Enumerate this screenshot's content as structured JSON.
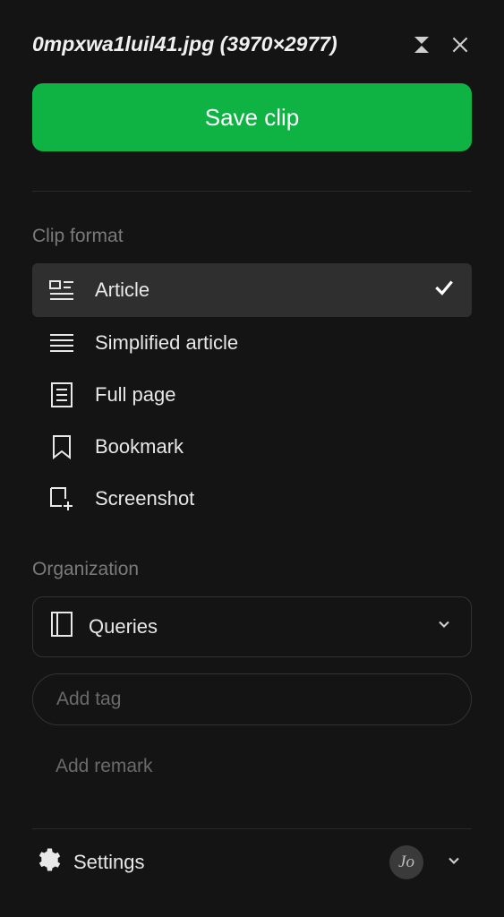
{
  "header": {
    "title": "0mpxwa1luil41.jpg (3970×2977)"
  },
  "save_button": {
    "label": "Save clip"
  },
  "clip_format": {
    "heading": "Clip format",
    "items": [
      {
        "label": "Article",
        "selected": true
      },
      {
        "label": "Simplified article",
        "selected": false
      },
      {
        "label": "Full page",
        "selected": false
      },
      {
        "label": "Bookmark",
        "selected": false
      },
      {
        "label": "Screenshot",
        "selected": false
      }
    ]
  },
  "organization": {
    "heading": "Organization",
    "notebook": {
      "label": "Queries"
    },
    "tag_input": {
      "placeholder": "Add tag"
    },
    "remark": {
      "label": "Add remark"
    }
  },
  "footer": {
    "settings": {
      "label": "Settings"
    },
    "avatar": {
      "initials": "Jo"
    }
  }
}
